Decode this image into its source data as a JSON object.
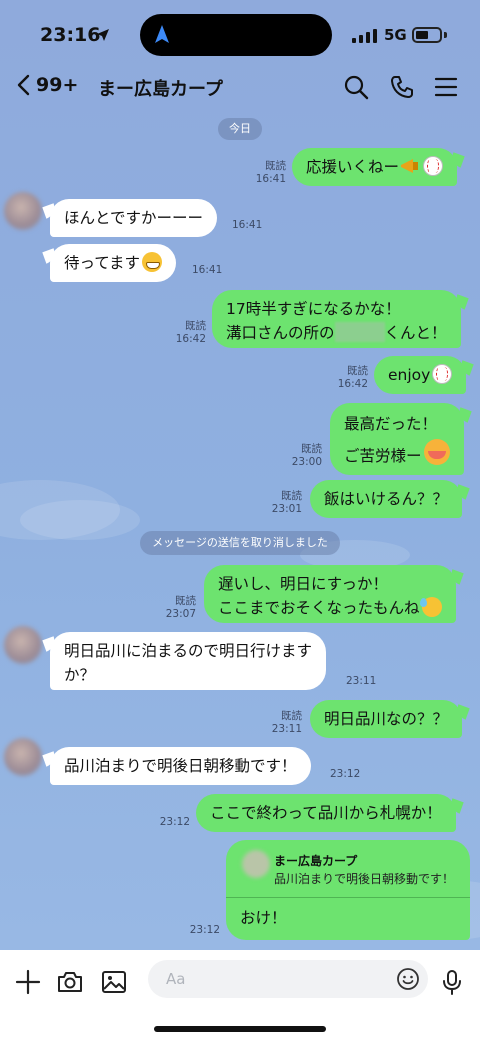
{
  "status_bar": {
    "time": "23:16",
    "network": "5G"
  },
  "header": {
    "back_count": "99+",
    "title": "まー広島カープ"
  },
  "date_label": "今日",
  "notice": "メッセージの送信を取り消しました",
  "messages": [
    {
      "dir": "out",
      "text": "応援いくねー",
      "emoji": "horn-baseball",
      "read": "既読",
      "time": "16:41"
    },
    {
      "dir": "in",
      "text": "ほんとですかーーー",
      "time": "16:41"
    },
    {
      "dir": "in",
      "text": "待ってます",
      "emoji": "grin",
      "time": "16:41"
    },
    {
      "dir": "out",
      "line1": "17時半すぎになるかな！",
      "line2a": "溝口さんの所の",
      "line2b": "くんと！",
      "read": "既読",
      "time": "16:42"
    },
    {
      "dir": "out",
      "text": "enjoy",
      "emoji": "baseball",
      "read": "既読",
      "time": "16:42"
    },
    {
      "dir": "out",
      "line1": "最高だった！",
      "line2": "ご苦労様ー",
      "emoji": "blush",
      "read": "既読",
      "time": "23:00"
    },
    {
      "dir": "out",
      "text": "飯はいけるん？？",
      "read": "既読",
      "time": "23:01"
    },
    {
      "dir": "out",
      "line1": "遅いし、明日にすっか！",
      "line2": "ここまでおそくなったもんね",
      "emoji": "sweat",
      "read": "既読",
      "time": "23:07"
    },
    {
      "dir": "in",
      "line1": "明日品川に泊まるので明日行けます",
      "line2": "か？",
      "time": "23:11"
    },
    {
      "dir": "out",
      "text": "明日品川なの？？",
      "read": "既読",
      "time": "23:11"
    },
    {
      "dir": "in",
      "text": "品川泊まりで明後日朝移動です！",
      "time": "23:12"
    },
    {
      "dir": "out",
      "text": "ここで終わって品川から札幌か！",
      "time": "23:12"
    }
  ],
  "reply": {
    "quoted_name": "まー広島カープ",
    "quoted_text": "品川泊まりで明後日朝移動です！",
    "text": "おけ！",
    "time": "23:12"
  },
  "input": {
    "placeholder": "Aa"
  },
  "icons": {
    "back": "chevron-left-icon",
    "search": "search-icon",
    "call": "phone-icon",
    "menu": "menu-icon",
    "add": "plus-icon",
    "camera": "camera-icon",
    "gallery": "image-icon",
    "emoji": "smiley-icon",
    "mic": "mic-icon"
  },
  "colors": {
    "chat_bg": "#8faadc",
    "outgoing": "#6de36f",
    "incoming": "#ffffff"
  }
}
